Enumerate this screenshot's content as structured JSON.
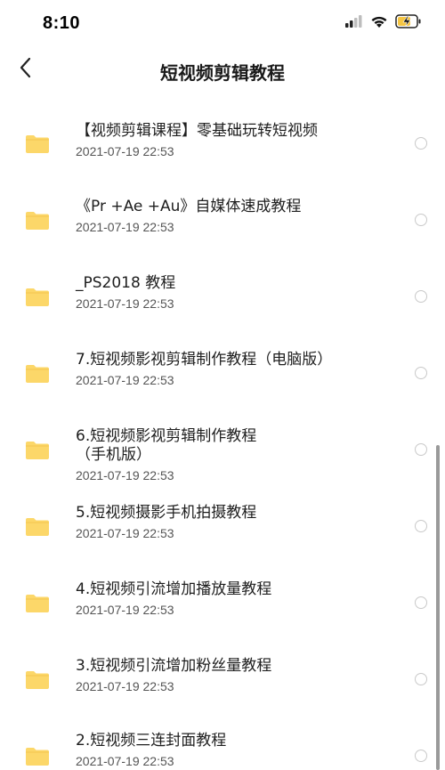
{
  "status_bar": {
    "time": "8:10",
    "icons": [
      "signal-icon",
      "wifi-icon",
      "battery-charging-icon"
    ],
    "battery_color": "#f5c542"
  },
  "header": {
    "title": "短视频剪辑教程",
    "back_icon": "chevron-left-icon"
  },
  "files": [
    {
      "name": "【视频剪辑课程】零基础玩转短视频",
      "date": "2021-07-19 22:53"
    },
    {
      "name": "《Pr +Ae +Au》自媒体速成教程",
      "date": "2021-07-19 22:53"
    },
    {
      "name": "_PS2018 教程",
      "date": "2021-07-19 22:53"
    },
    {
      "name": "7.短视频影视剪辑制作教程（电脑版）",
      "date": "2021-07-19 22:53"
    },
    {
      "name": "6.短视频影视剪辑制作教程\n（手机版）",
      "date": "2021-07-19 22:53"
    },
    {
      "name": "5.短视频摄影手机拍摄教程",
      "date": "2021-07-19 22:53"
    },
    {
      "name": "4.短视频引流增加播放量教程",
      "date": "2021-07-19 22:53"
    },
    {
      "name": "3.短视频引流增加粉丝量教程",
      "date": "2021-07-19 22:53"
    },
    {
      "name": "2.短视频三连封面教程",
      "date": "2021-07-19 22:53"
    }
  ],
  "colors": {
    "folder": "#fcd769",
    "radio_border": "#c9c9c9"
  }
}
